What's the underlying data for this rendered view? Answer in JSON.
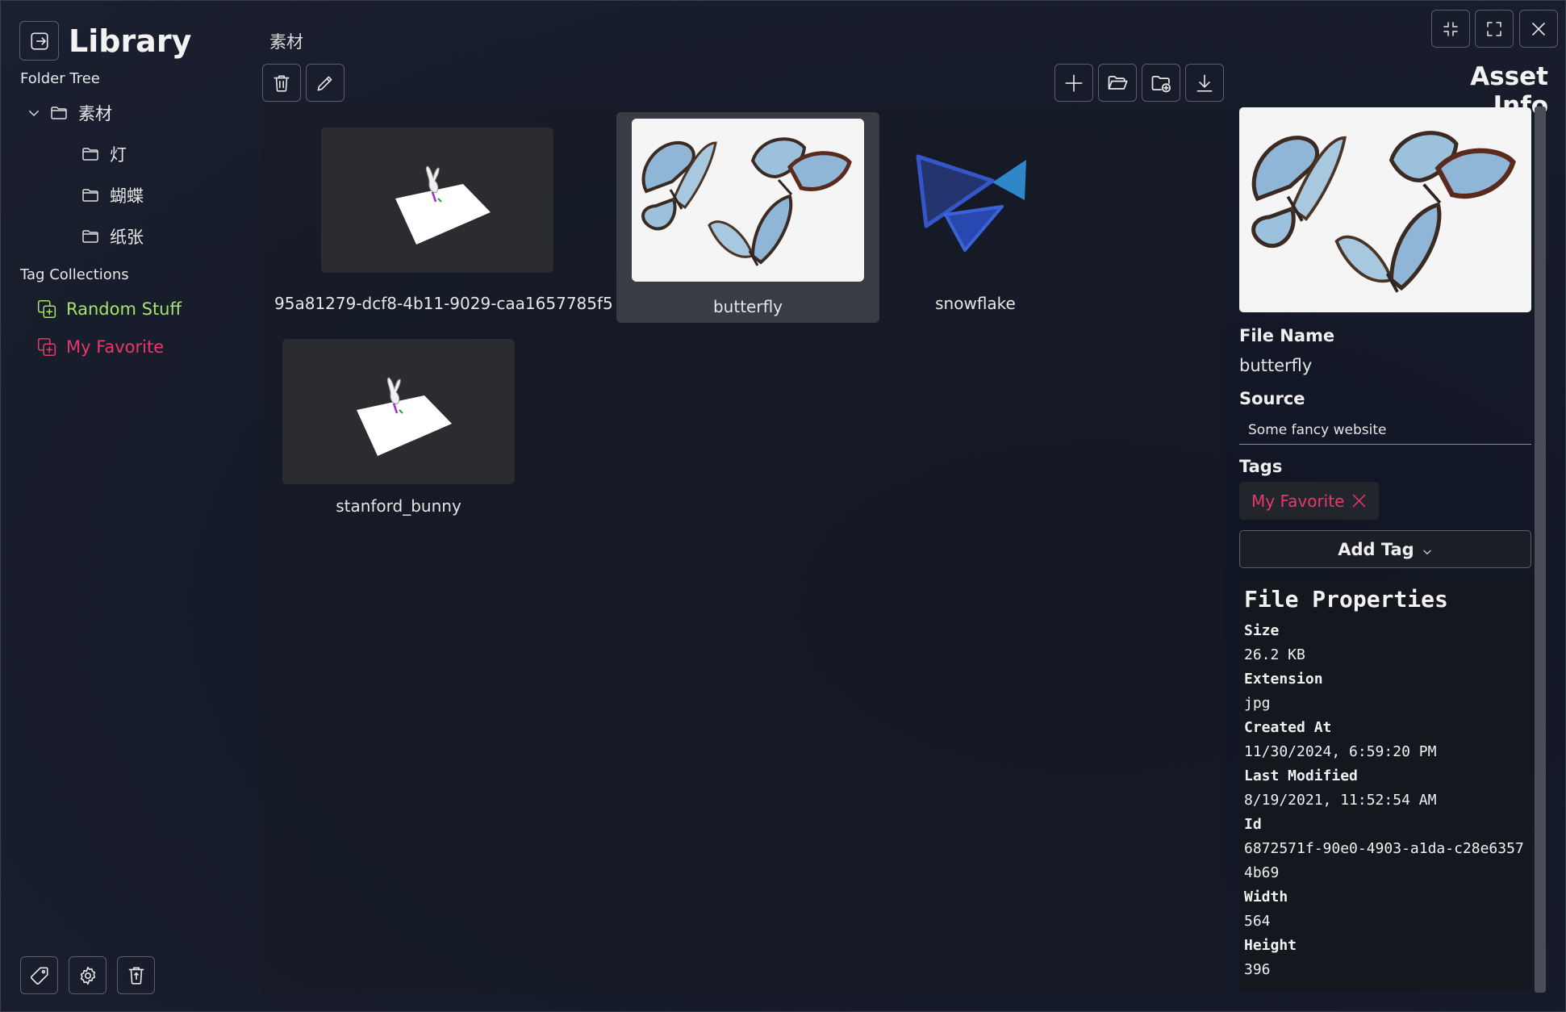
{
  "app": {
    "title": "Library"
  },
  "sidebar": {
    "folder_tree_label": "Folder Tree",
    "folders": [
      {
        "label": "素材",
        "expanded": true
      },
      {
        "label": "灯"
      },
      {
        "label": "蝴蝶"
      },
      {
        "label": "纸张"
      }
    ],
    "tag_collections_label": "Tag Collections",
    "tags": [
      {
        "label": "Random Stuff",
        "color": "#a6e36b"
      },
      {
        "label": "My Favorite",
        "color": "#e8386b"
      }
    ]
  },
  "main": {
    "breadcrumb": "素材",
    "assets": [
      {
        "name": "95a81279-dcf8-4b11-9029-caa1657785f5",
        "kind": "3d-model"
      },
      {
        "name": "butterfly",
        "kind": "image",
        "selected": true
      },
      {
        "name": "snowflake",
        "kind": "image"
      },
      {
        "name": "stanford_bunny",
        "kind": "3d-model"
      }
    ]
  },
  "panel": {
    "title": "Asset Info",
    "file_name_label": "File Name",
    "file_name": "butterfly",
    "source_label": "Source",
    "source_value": "Some fancy website",
    "tags_label": "Tags",
    "tag": "My Favorite",
    "add_tag_label": "Add Tag",
    "properties_title": "File Properties",
    "properties": [
      {
        "label": "Size",
        "value": "26.2 KB"
      },
      {
        "label": "Extension",
        "value": "jpg"
      },
      {
        "label": "Created At",
        "value": "11/30/2024, 6:59:20 PM"
      },
      {
        "label": "Last Modified",
        "value": "8/19/2021, 11:52:54 AM"
      },
      {
        "label": "Id",
        "value": "6872571f-90e0-4903-a1da-c28e63574b69"
      },
      {
        "label": "Width",
        "value": "564"
      },
      {
        "label": "Height",
        "value": "396"
      }
    ]
  },
  "colors": {
    "accent_pink": "#e8386b",
    "accent_green": "#a6e36b",
    "selected_card": "#3a3c44"
  }
}
